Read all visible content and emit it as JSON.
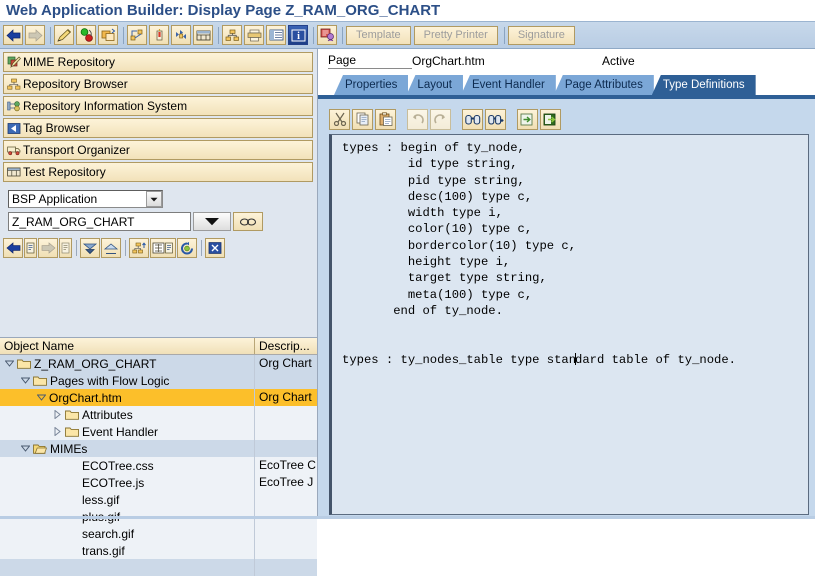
{
  "window": {
    "title": "Web Application Builder: Display Page Z_RAM_ORG_CHART"
  },
  "main_toolbar": {
    "buttons": [
      {
        "name": "back-arrow-button",
        "icon": "back-arrow-icon"
      },
      {
        "name": "forward-arrow-button",
        "icon": "forward-arrow-icon"
      },
      {
        "name": "change-display-button",
        "icon": "pencil-icon"
      },
      {
        "name": "activate-button",
        "icon": "activate-icon"
      },
      {
        "name": "copy-object-button",
        "icon": "copy-object-icon"
      },
      {
        "name": "other-object-button",
        "icon": "other-object-icon"
      },
      {
        "name": "generate-button",
        "icon": "candle-icon"
      },
      {
        "name": "navigate-button",
        "icon": "navigate-icon"
      },
      {
        "name": "test-button",
        "icon": "test-icon"
      },
      {
        "name": "hierarchy-button",
        "icon": "hierarchy-icon"
      },
      {
        "name": "print-button",
        "icon": "print-icon"
      },
      {
        "name": "table-button",
        "icon": "table-icon"
      },
      {
        "name": "info-button",
        "icon": "info-icon"
      },
      {
        "name": "where-used-button",
        "icon": "where-used-icon"
      }
    ],
    "template_label": "Template",
    "pretty_printer_label": "Pretty Printer",
    "signature_label": "Signature"
  },
  "sidebar": {
    "items": [
      {
        "label": "MIME Repository",
        "icon": "mime-repository-icon"
      },
      {
        "label": "Repository Browser",
        "icon": "repository-browser-icon"
      },
      {
        "label": "Repository Information System",
        "icon": "repository-info-icon"
      },
      {
        "label": "Tag Browser",
        "icon": "tag-browser-icon"
      },
      {
        "label": "Transport Organizer",
        "icon": "transport-organizer-icon"
      },
      {
        "label": "Test Repository",
        "icon": "test-repository-icon"
      }
    ],
    "object_type": "BSP Application",
    "object_name": "Z_RAM_ORG_CHART",
    "tree_toolbar": [
      {
        "name": "tree-back-button",
        "icon": "back-arrow-icon"
      },
      {
        "name": "tree-back-list-button",
        "icon": "list-icon"
      },
      {
        "name": "tree-forward-button",
        "icon": "forward-arrow-icon"
      },
      {
        "name": "tree-forward-list-button",
        "icon": "list-icon"
      },
      {
        "name": "expand-all-button",
        "icon": "expand-down-icon"
      },
      {
        "name": "collapse-all-button",
        "icon": "collapse-up-icon"
      },
      {
        "name": "object-list-button",
        "icon": "hierarchy-icon"
      },
      {
        "name": "filter-button",
        "icon": "filter-icon"
      },
      {
        "name": "refresh-button",
        "icon": "refresh-icon"
      },
      {
        "name": "close-button",
        "icon": "close-x-icon"
      }
    ]
  },
  "tree": {
    "columns": [
      "Object Name",
      "Descrip..."
    ],
    "rows": [
      {
        "label": "Z_RAM_ORG_CHART",
        "desc": "Org Chart",
        "indent": 0,
        "toggle": "expanded",
        "folder": true,
        "style": "band",
        "selected": false
      },
      {
        "label": "Pages with Flow Logic",
        "desc": "",
        "indent": 1,
        "toggle": "expanded",
        "folder": true,
        "style": "band",
        "selected": false
      },
      {
        "label": "OrgChart.htm",
        "desc": "Org Chart",
        "indent": 2,
        "toggle": "expanded",
        "folder": false,
        "style": "plain",
        "selected": true
      },
      {
        "label": "Attributes",
        "desc": "",
        "indent": 3,
        "toggle": "collapsed",
        "folder": true,
        "style": "plain",
        "selected": false
      },
      {
        "label": "Event Handler",
        "desc": "",
        "indent": 3,
        "toggle": "collapsed",
        "folder": true,
        "style": "plain",
        "selected": false
      },
      {
        "label": "MIMEs",
        "desc": "",
        "indent": 1,
        "toggle": "expanded",
        "folder": true,
        "style": "band",
        "selected": false
      },
      {
        "label": "ECOTree.css",
        "desc": "EcoTree C",
        "indent": 3,
        "toggle": "none",
        "folder": false,
        "style": "plain",
        "selected": false
      },
      {
        "label": "ECOTree.js",
        "desc": "EcoTree J",
        "indent": 3,
        "toggle": "none",
        "folder": false,
        "style": "plain",
        "selected": false
      },
      {
        "label": "less.gif",
        "desc": "",
        "indent": 3,
        "toggle": "none",
        "folder": false,
        "style": "plain",
        "selected": false
      },
      {
        "label": "plus.gif",
        "desc": "",
        "indent": 3,
        "toggle": "none",
        "folder": false,
        "style": "plain",
        "selected": false
      },
      {
        "label": "search.gif",
        "desc": "",
        "indent": 3,
        "toggle": "none",
        "folder": false,
        "style": "plain",
        "selected": false
      },
      {
        "label": "trans.gif",
        "desc": "",
        "indent": 3,
        "toggle": "none",
        "folder": false,
        "style": "plain",
        "selected": false
      },
      {
        "label": "",
        "desc": "",
        "indent": 3,
        "toggle": "none",
        "folder": false,
        "style": "band",
        "selected": false
      }
    ]
  },
  "page_header": {
    "label": "Page",
    "value": "OrgChart.htm",
    "status": "Active"
  },
  "tabs": [
    {
      "label": "Properties",
      "selected": false
    },
    {
      "label": "Layout",
      "selected": false
    },
    {
      "label": "Event Handler",
      "selected": false
    },
    {
      "label": "Page Attributes",
      "selected": false
    },
    {
      "label": "Type Definitions",
      "selected": true
    }
  ],
  "editor_toolbar": [
    {
      "name": "cut-button",
      "icon": "scissors-icon",
      "enabled": true
    },
    {
      "name": "copy-button",
      "icon": "copy-icon",
      "enabled": true
    },
    {
      "name": "paste-button",
      "icon": "paste-icon",
      "enabled": true
    },
    {
      "name": "undo-button",
      "icon": "undo-icon",
      "enabled": false
    },
    {
      "name": "redo-button",
      "icon": "redo-icon",
      "enabled": false
    },
    {
      "name": "find-button",
      "icon": "binoculars-icon",
      "enabled": true
    },
    {
      "name": "find-next-button",
      "icon": "binoculars-plus-icon",
      "enabled": true
    },
    {
      "name": "import-button",
      "icon": "import-arrow-icon",
      "enabled": true
    },
    {
      "name": "export-button",
      "icon": "export-arrow-icon",
      "enabled": true
    }
  ],
  "code": {
    "before_caret": "types : begin of ty_node,\n         id type string,\n         pid type string,\n         desc(100) type c,\n         width type i,\n         color(10) type c,\n         bordercolor(10) type c,\n         height type i,\n         target type string,\n         meta(100) type c,\n       end of ty_node.\n\n\ntypes : ty_nodes_table type stan",
    "after_caret": "dard table of ty_node."
  },
  "colors": {
    "title_blue": "#2c4f87",
    "tab_selected": "#2e5f96",
    "tab_normal": "#7ba7d7",
    "row_selected": "#fcbf2a",
    "toolbar_gradient_top": "#c7d8ea",
    "panel_bg": "#c5d8ec",
    "code_bg": "#dce6f1",
    "button_tan": "#f0dfb4"
  }
}
